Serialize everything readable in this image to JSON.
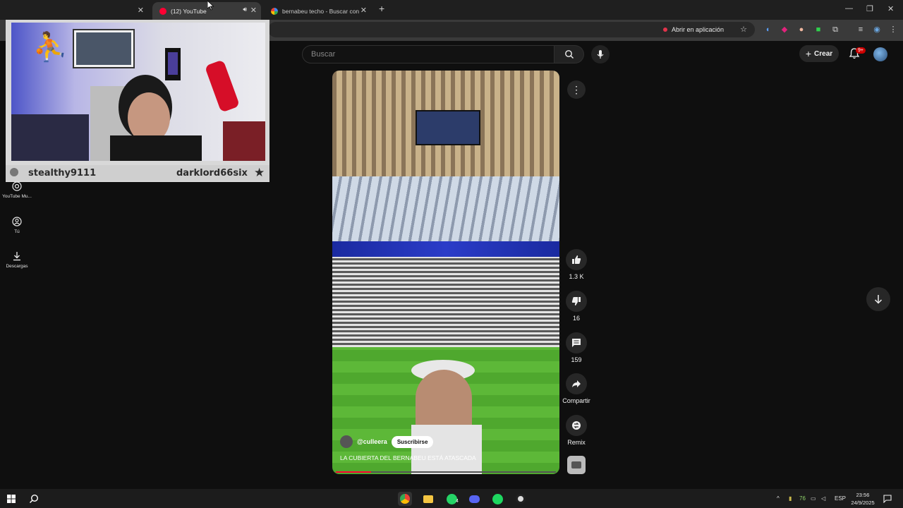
{
  "browser": {
    "tabs": [
      {
        "label": "",
        "active": false
      },
      {
        "label": "(12) YouTube",
        "active": true
      },
      {
        "label": "bernabeu techo - Buscar con G",
        "active": false
      }
    ],
    "open_in_app": "Abrir en aplicación",
    "new_tab_symbol": "+"
  },
  "youtube": {
    "search_placeholder": "Buscar",
    "create_label": "Crear",
    "notifications_badge": "9+"
  },
  "sidebar": {
    "items": [
      {
        "label": "YouTube Mu...",
        "icon": "music-icon"
      },
      {
        "label": "Tú",
        "icon": "user-icon"
      },
      {
        "label": "Descargas",
        "icon": "download-icon"
      }
    ]
  },
  "webcam": {
    "name_left": "stealthy9111",
    "name_right": "darklord66six"
  },
  "short": {
    "channel": "@culleera",
    "subscribe_label": "Suscribirse",
    "title": "LA CUBIERTA DEL BERNABEU ESTÁ ATASCADA",
    "progress": 0.16,
    "likes": "1.3 K",
    "dislikes": "16",
    "comments": "159",
    "share_label": "Compartir",
    "remix_label": "Remix"
  },
  "taskbar": {
    "whatsapp_badge": "4",
    "tray_temp": "76",
    "language": "ESP",
    "time": "23:56",
    "date": "24/9/2025"
  },
  "colors": {
    "youtube_red": "#ff0033",
    "background": "#0f0f0f",
    "accent_green": "#1ed760"
  }
}
